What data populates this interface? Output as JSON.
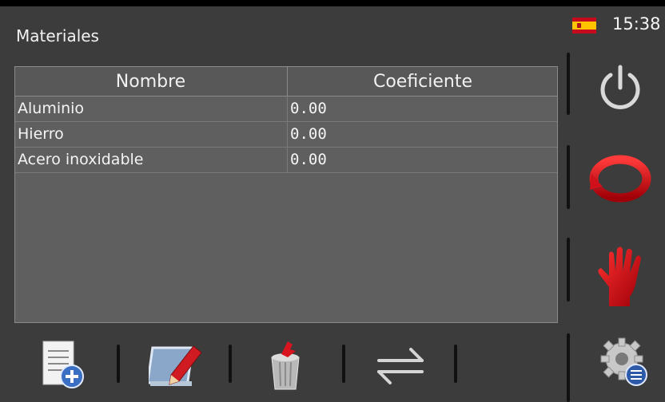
{
  "header": {
    "title": "Materiales",
    "time": "15:38",
    "language_flag": "spain-flag-icon"
  },
  "table": {
    "columns": [
      "Nombre",
      "Coeficiente"
    ],
    "rows": [
      {
        "name": "Aluminio",
        "coefficient": "0.00"
      },
      {
        "name": "Hierro",
        "coefficient": "0.00"
      },
      {
        "name": "Acero inoxidable",
        "coefficient": "0.00"
      }
    ]
  },
  "sidebar": {
    "buttons": [
      {
        "icon": "power-icon"
      },
      {
        "icon": "refresh-icon",
        "color": "#e0141e"
      },
      {
        "icon": "hand-stop-icon",
        "color": "#d4141e"
      },
      {
        "icon": "settings-gear-icon"
      }
    ]
  },
  "toolbar": {
    "buttons": [
      {
        "icon": "new-document-icon"
      },
      {
        "icon": "edit-icon"
      },
      {
        "icon": "delete-trash-icon"
      },
      {
        "icon": "swap-arrows-icon"
      }
    ]
  },
  "colors": {
    "background": "#3c3c3c",
    "table_background": "#5f5f5f",
    "accent_red": "#e0141e"
  }
}
